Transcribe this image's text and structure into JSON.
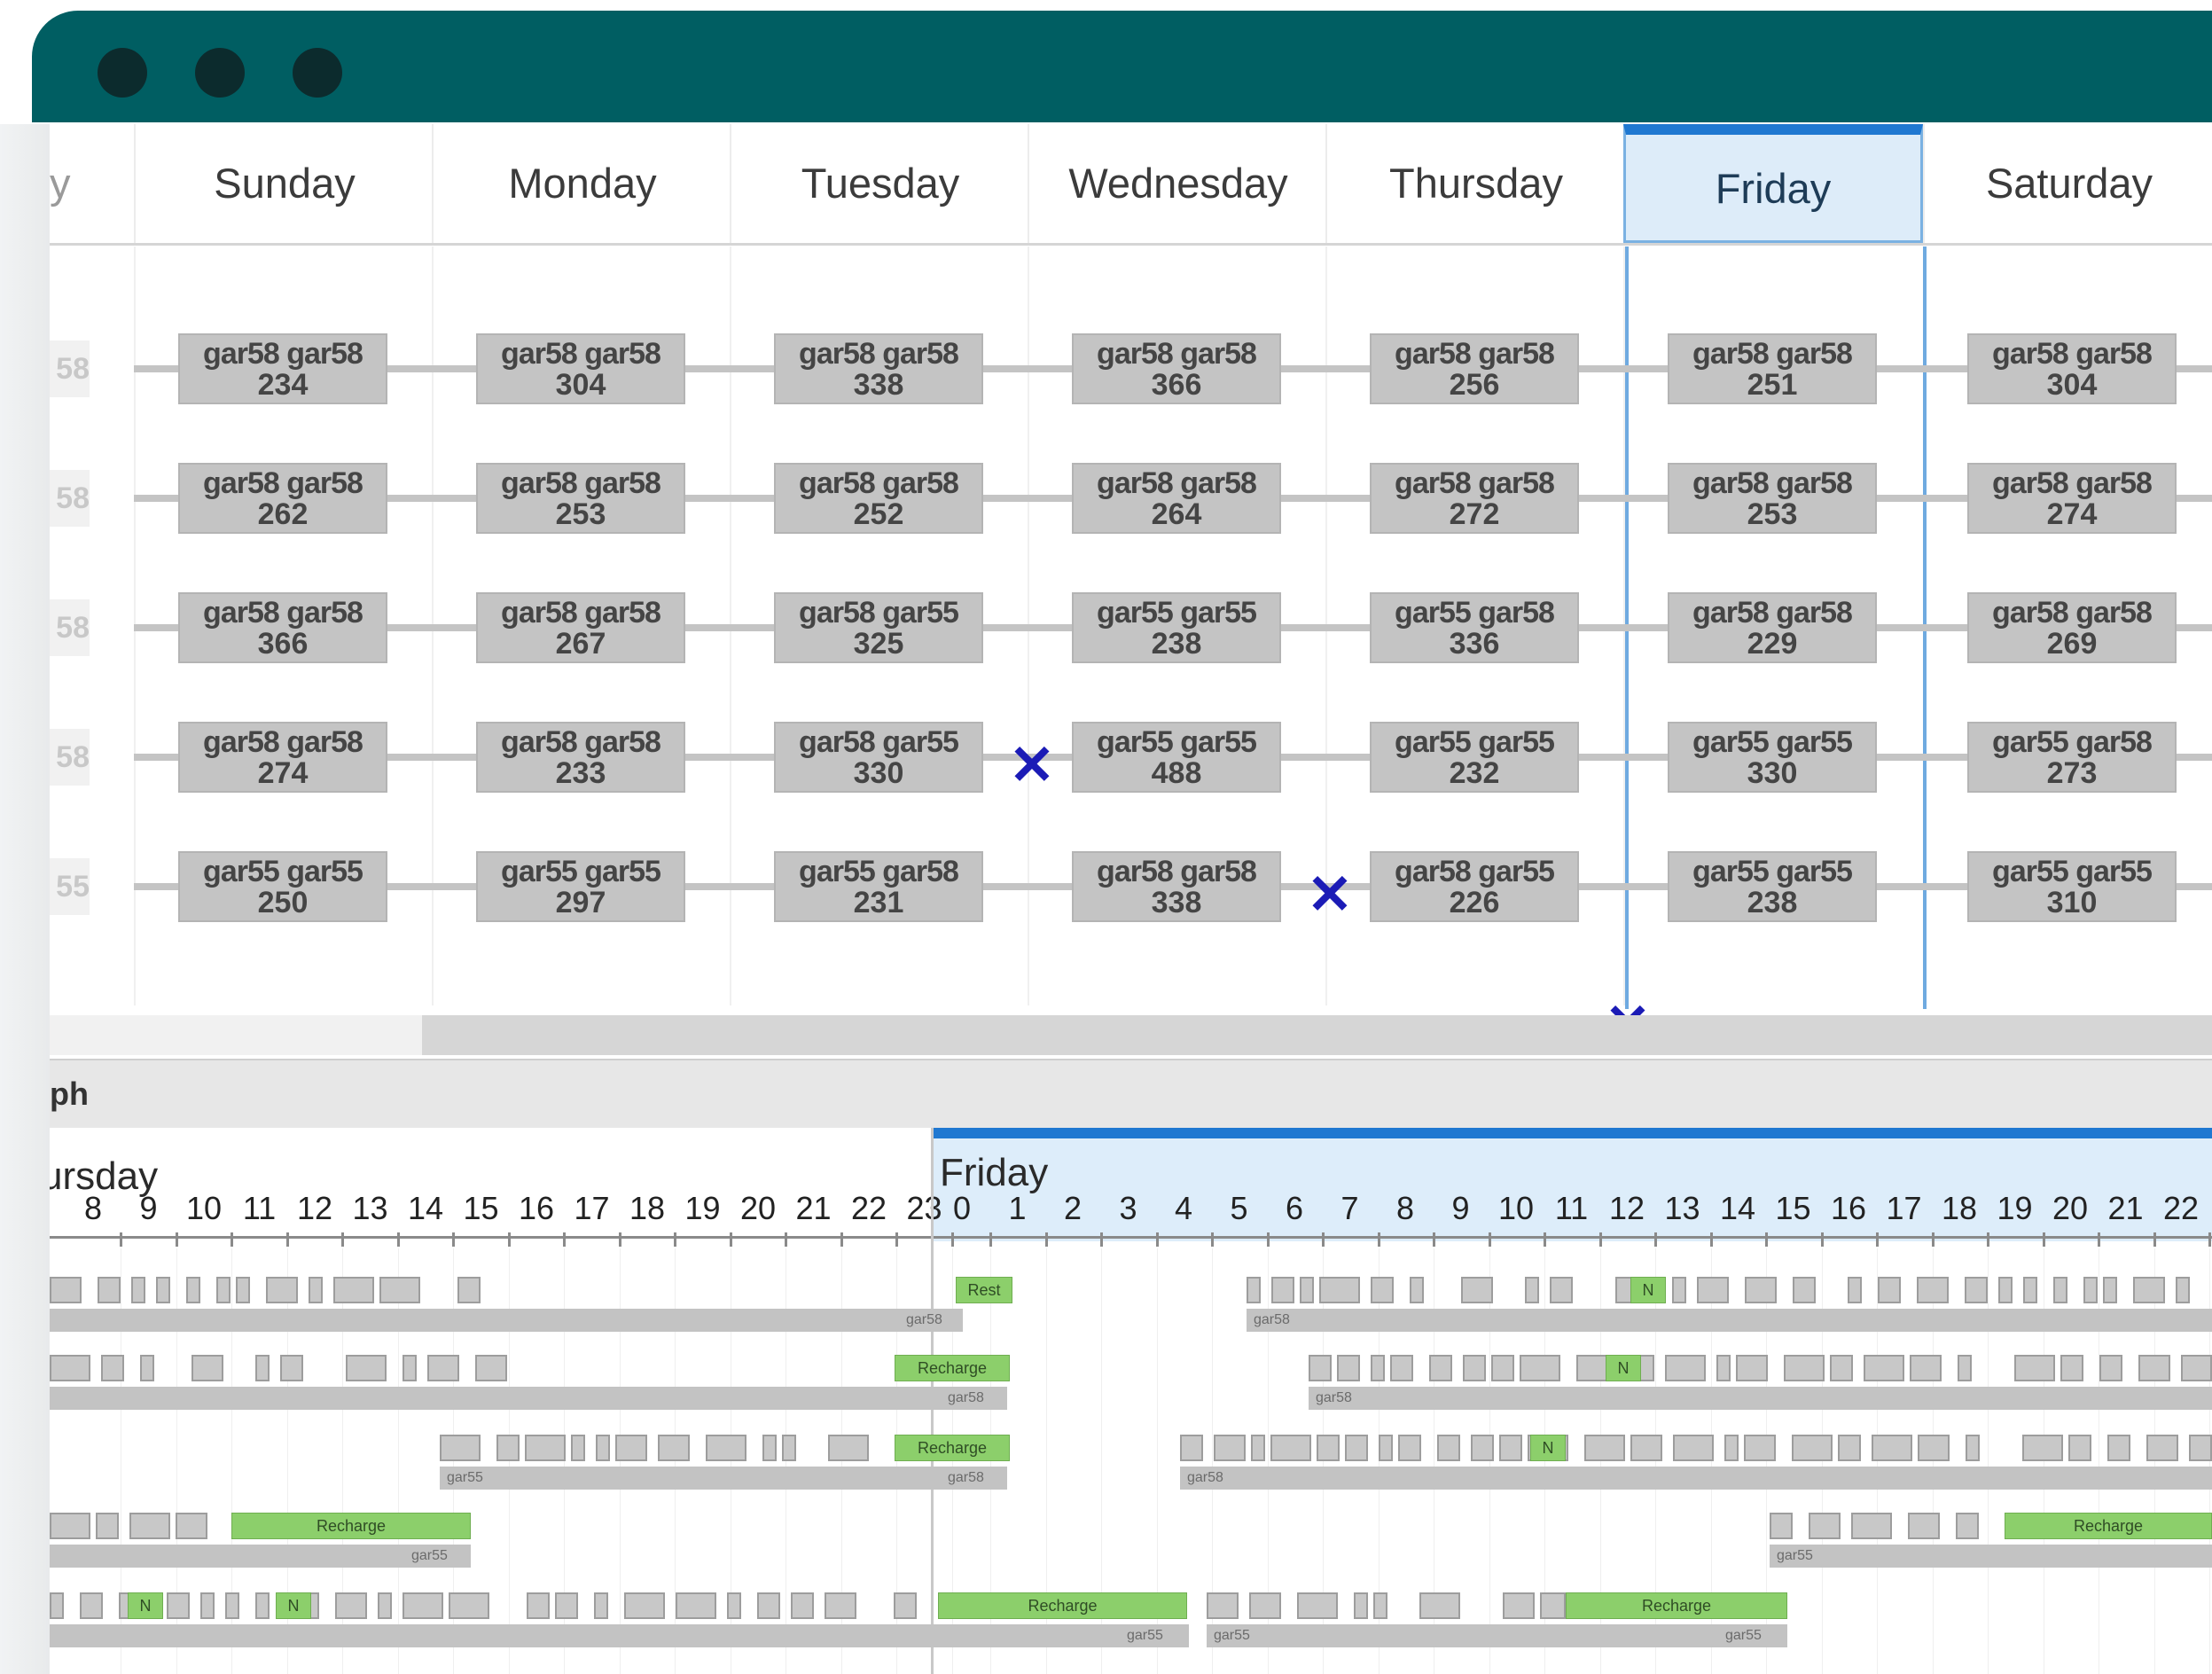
{
  "days": [
    "y",
    "Sunday",
    "Monday",
    "Tuesday",
    "Wednesday",
    "Thursday",
    "Friday",
    "Saturday"
  ],
  "selected_day": "Friday",
  "row_stubs": [
    "58",
    "58",
    "58",
    "58",
    "55"
  ],
  "rows": [
    [
      [
        "gar58 gar58",
        "234"
      ],
      [
        "gar58 gar58",
        "304"
      ],
      [
        "gar58 gar58",
        "338"
      ],
      [
        "gar58 gar58",
        "366"
      ],
      [
        "gar58 gar58",
        "256"
      ],
      [
        "gar58 gar58",
        "251"
      ],
      [
        "gar58 gar58",
        "304"
      ]
    ],
    [
      [
        "gar58 gar58",
        "262"
      ],
      [
        "gar58 gar58",
        "253"
      ],
      [
        "gar58 gar58",
        "252"
      ],
      [
        "gar58 gar58",
        "264"
      ],
      [
        "gar58 gar58",
        "272"
      ],
      [
        "gar58 gar58",
        "253"
      ],
      [
        "gar58 gar58",
        "274"
      ]
    ],
    [
      [
        "gar58 gar58",
        "366"
      ],
      [
        "gar58 gar58",
        "267"
      ],
      [
        "gar58 gar55",
        "325"
      ],
      [
        "gar55 gar55",
        "238"
      ],
      [
        "gar55 gar58",
        "336"
      ],
      [
        "gar58 gar58",
        "229"
      ],
      [
        "gar58 gar58",
        "269"
      ]
    ],
    [
      [
        "gar58 gar58",
        "274"
      ],
      [
        "gar58 gar58",
        "233"
      ],
      [
        "gar58 gar55",
        "330"
      ],
      [
        "gar55 gar55",
        "488"
      ],
      [
        "gar55 gar55",
        "232"
      ],
      [
        "gar55 gar55",
        "330"
      ],
      [
        "gar55 gar58",
        "273"
      ]
    ],
    [
      [
        "gar55 gar55",
        "250"
      ],
      [
        "gar55 gar55",
        "297"
      ],
      [
        "gar55 gar58",
        "231"
      ],
      [
        "gar58 gar58",
        "338"
      ],
      [
        "gar58 gar55",
        "226"
      ],
      [
        "gar55 gar55",
        "238"
      ],
      [
        "gar55 gar55",
        "310"
      ]
    ]
  ],
  "graph": {
    "title": "ph",
    "prev_day": "ursday",
    "day": "Friday",
    "prev_hours": [
      "8",
      "9",
      "10",
      "11",
      "12",
      "13",
      "14",
      "15",
      "16",
      "17",
      "18",
      "19",
      "20",
      "21",
      "22",
      "23"
    ],
    "hours": [
      "0",
      "1",
      "2",
      "3",
      "4",
      "5",
      "6",
      "7",
      "8",
      "9",
      "10",
      "11",
      "12",
      "13",
      "14",
      "15",
      "16",
      "17",
      "18",
      "19",
      "20",
      "21",
      "22"
    ],
    "labels": {
      "rest": "Rest",
      "recharge": "Recharge",
      "small": "N",
      "gar58": "gar58",
      "gar55": "gar55"
    }
  }
}
